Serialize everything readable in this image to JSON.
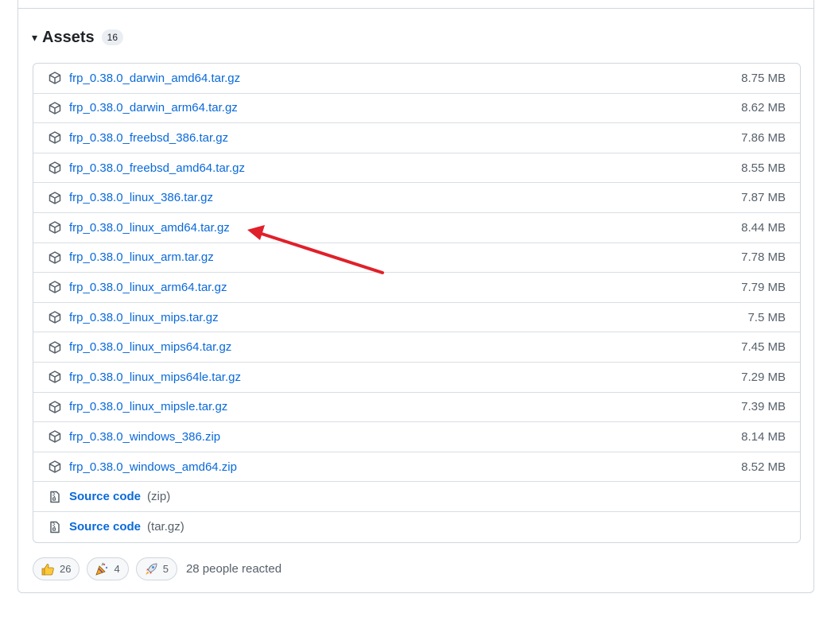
{
  "assets": {
    "title": "Assets",
    "count": "16",
    "caret_icon": "triangle-down-icon"
  },
  "files": [
    {
      "name": "frp_0.38.0_darwin_amd64.tar.gz",
      "size": "8.75 MB"
    },
    {
      "name": "frp_0.38.0_darwin_arm64.tar.gz",
      "size": "8.62 MB"
    },
    {
      "name": "frp_0.38.0_freebsd_386.tar.gz",
      "size": "7.86 MB"
    },
    {
      "name": "frp_0.38.0_freebsd_amd64.tar.gz",
      "size": "8.55 MB"
    },
    {
      "name": "frp_0.38.0_linux_386.tar.gz",
      "size": "7.87 MB"
    },
    {
      "name": "frp_0.38.0_linux_amd64.tar.gz",
      "size": "8.44 MB"
    },
    {
      "name": "frp_0.38.0_linux_arm.tar.gz",
      "size": "7.78 MB"
    },
    {
      "name": "frp_0.38.0_linux_arm64.tar.gz",
      "size": "7.79 MB"
    },
    {
      "name": "frp_0.38.0_linux_mips.tar.gz",
      "size": "7.5 MB"
    },
    {
      "name": "frp_0.38.0_linux_mips64.tar.gz",
      "size": "7.45 MB"
    },
    {
      "name": "frp_0.38.0_linux_mips64le.tar.gz",
      "size": "7.29 MB"
    },
    {
      "name": "frp_0.38.0_linux_mipsle.tar.gz",
      "size": "7.39 MB"
    },
    {
      "name": "frp_0.38.0_windows_386.zip",
      "size": "8.14 MB"
    },
    {
      "name": "frp_0.38.0_windows_amd64.zip",
      "size": "8.52 MB"
    }
  ],
  "source": [
    {
      "label": "Source code",
      "ext": "(zip)"
    },
    {
      "label": "Source code",
      "ext": "(tar.gz)"
    }
  ],
  "reactions": [
    {
      "emoji": "thumbs-up-icon",
      "count": "26"
    },
    {
      "emoji": "party-popper-icon",
      "count": "4"
    },
    {
      "emoji": "rocket-icon",
      "count": "5"
    }
  ],
  "reacted_text": "28 people reacted",
  "colors": {
    "link": "#0969da",
    "annotation_arrow": "#e0202a"
  }
}
